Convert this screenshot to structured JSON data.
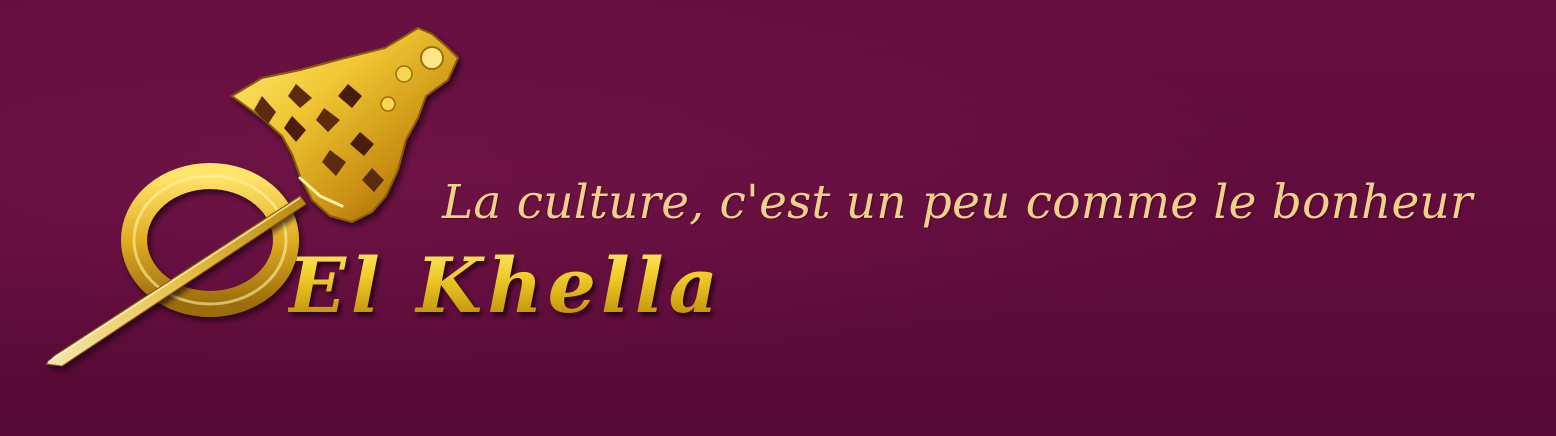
{
  "banner": {
    "tagline": "La culture, c'est un peu comme le bonheur",
    "brand_name": "El Khella",
    "logo_icon": "golden-khella-brooch-pin-icon"
  },
  "colors": {
    "background": "#5e0c3b",
    "tagline": "#efd08a",
    "gold": "#e4c022"
  }
}
